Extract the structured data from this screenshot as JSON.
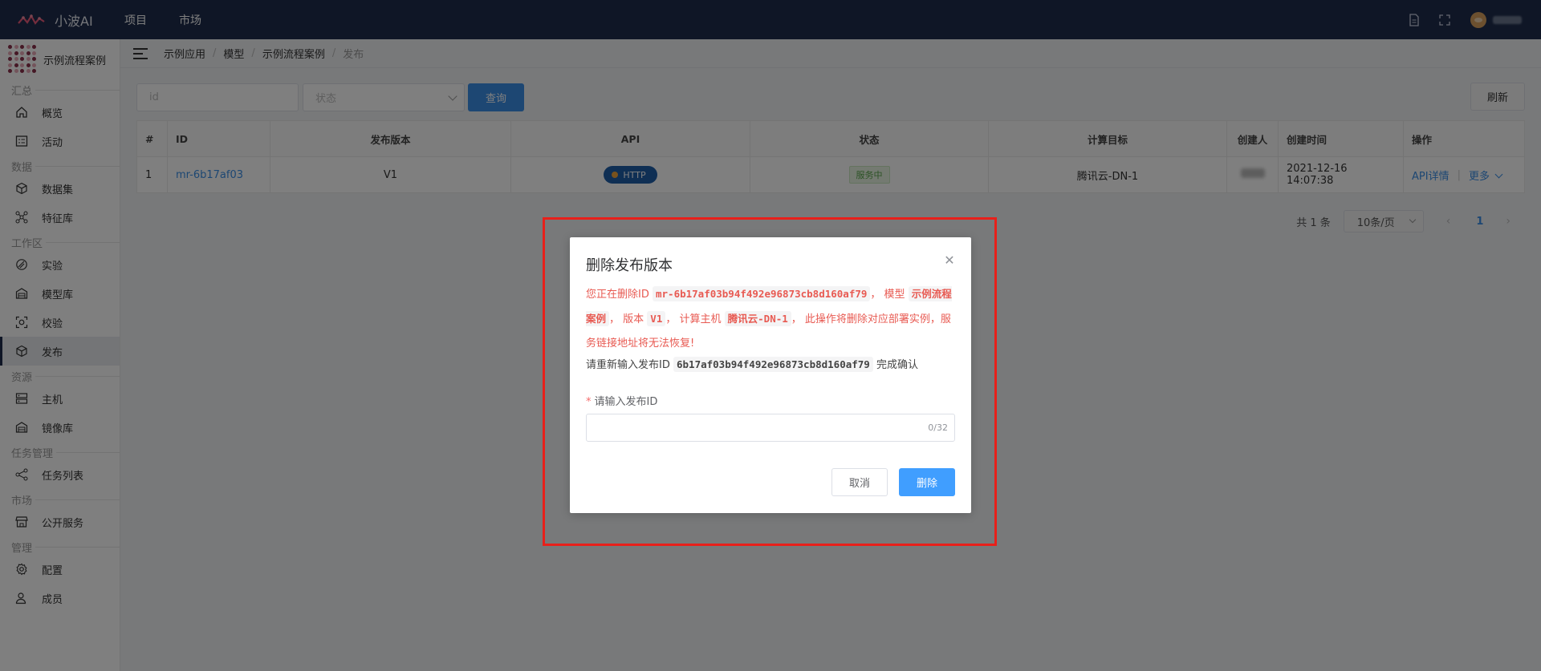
{
  "app": {
    "name": "小波AI"
  },
  "topnav": {
    "items": [
      "项目",
      "市场"
    ]
  },
  "topbar_icons": [
    "document-icon",
    "fullscreen-icon",
    "avatar"
  ],
  "sidebar": {
    "project_name": "示例流程案例",
    "groups": [
      {
        "label": "汇总",
        "items": [
          {
            "label": "概览",
            "icon": "home-icon"
          },
          {
            "label": "活动",
            "icon": "activity-icon"
          }
        ]
      },
      {
        "label": "数据",
        "items": [
          {
            "label": "数据集",
            "icon": "cube-icon"
          },
          {
            "label": "特征库",
            "icon": "nodes-icon"
          }
        ]
      },
      {
        "label": "工作区",
        "items": [
          {
            "label": "实验",
            "icon": "experiment-icon"
          },
          {
            "label": "模型库",
            "icon": "warehouse-icon"
          },
          {
            "label": "校验",
            "icon": "scan-icon"
          },
          {
            "label": "发布",
            "icon": "package-icon",
            "active": true
          }
        ]
      },
      {
        "label": "资源",
        "items": [
          {
            "label": "主机",
            "icon": "server-icon"
          },
          {
            "label": "镜像库",
            "icon": "warehouse-icon"
          }
        ]
      },
      {
        "label": "任务管理",
        "items": [
          {
            "label": "任务列表",
            "icon": "share-icon"
          }
        ]
      },
      {
        "label": "市场",
        "items": [
          {
            "label": "公开服务",
            "icon": "store-icon"
          }
        ]
      },
      {
        "label": "管理",
        "items": [
          {
            "label": "配置",
            "icon": "gear-icon"
          },
          {
            "label": "成员",
            "icon": "user-icon"
          }
        ]
      }
    ]
  },
  "breadcrumb": [
    "示例应用",
    "模型",
    "示例流程案例",
    "发布"
  ],
  "filters": {
    "id_placeholder": "id",
    "status_placeholder": "状态",
    "query_label": "查询",
    "refresh_label": "刷新"
  },
  "table": {
    "headers": [
      "#",
      "ID",
      "发布版本",
      "API",
      "状态",
      "计算目标",
      "创建人",
      "创建时间",
      "操作"
    ],
    "rows": [
      {
        "index": "1",
        "id": "mr-6b17af03",
        "version": "V1",
        "api": "HTTP",
        "status": "服务中",
        "target": "腾讯云-DN-1",
        "created_at": "2021-12-16 14:07:38",
        "op_detail": "API详情",
        "op_more": "更多"
      }
    ]
  },
  "pager": {
    "total": "共 1 条",
    "page_size": "10条/页",
    "current": "1"
  },
  "dialog": {
    "title": "删除发布版本",
    "warn_p1": "您正在删除ID",
    "warn_id": "mr-6b17af03b94f492e96873cb8d160af79",
    "warn_p2": "， 模型",
    "warn_model": "示例流程案例",
    "warn_p3": "， 版本",
    "warn_version": "V1",
    "warn_p4": "， 计算主机",
    "warn_host": "腾讯云-DN-1",
    "warn_p5": "， 此操作将删除对应部署实例，服务链接地址将无法恢复!",
    "confirm_p1": "请重新输入发布ID",
    "confirm_id": "6b17af03b94f492e96873cb8d160af79",
    "confirm_p2": "完成确认",
    "field_required": "*",
    "field_label": "请输入发布ID",
    "field_count": "0/32",
    "cancel_label": "取消",
    "delete_label": "删除"
  },
  "colors": {
    "topbar": "#1f2d4d",
    "primary": "#409eff",
    "danger_text": "#e85a52",
    "highlight_border": "#e8201a"
  }
}
